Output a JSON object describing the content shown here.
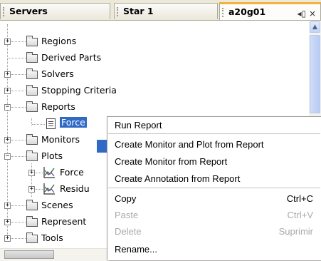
{
  "tabs": {
    "servers": "Servers",
    "star": "Star 1",
    "active": "a20g01",
    "active_controls": "◂▯ ×"
  },
  "tree": {
    "items": [
      {
        "label": "Regions"
      },
      {
        "label": "Derived Parts"
      },
      {
        "label": "Solvers"
      },
      {
        "label": "Stopping Criteria"
      },
      {
        "label": "Reports"
      },
      {
        "label": "Force"
      },
      {
        "label": "Monitors"
      },
      {
        "label": "Plots"
      },
      {
        "label": "Force"
      },
      {
        "label": "Residu"
      },
      {
        "label": "Scenes"
      },
      {
        "label": "Represent"
      },
      {
        "label": "Tools"
      }
    ]
  },
  "context_menu": {
    "items": [
      {
        "label": "Run Report",
        "shortcut": ""
      },
      {
        "label": "Create Monitor and Plot from Report",
        "shortcut": ""
      },
      {
        "label": "Create Monitor from Report",
        "shortcut": ""
      },
      {
        "label": "Create Annotation from Report",
        "shortcut": ""
      },
      {
        "label": "Copy",
        "shortcut": "Ctrl+C"
      },
      {
        "label": "Paste",
        "shortcut": "Ctrl+V"
      },
      {
        "label": "Delete",
        "shortcut": "Suprimir"
      },
      {
        "label": "Rename...",
        "shortcut": ""
      }
    ]
  },
  "icons": {
    "folder": "folder-icon",
    "report": "report-icon",
    "plot": "plot-icon",
    "expand": "expand-icon",
    "collapse": "collapse-icon"
  },
  "colors": {
    "selection": "#316ac5",
    "active_tab_accent": "#f3b13e",
    "disabled_text": "#a9a9a9"
  }
}
